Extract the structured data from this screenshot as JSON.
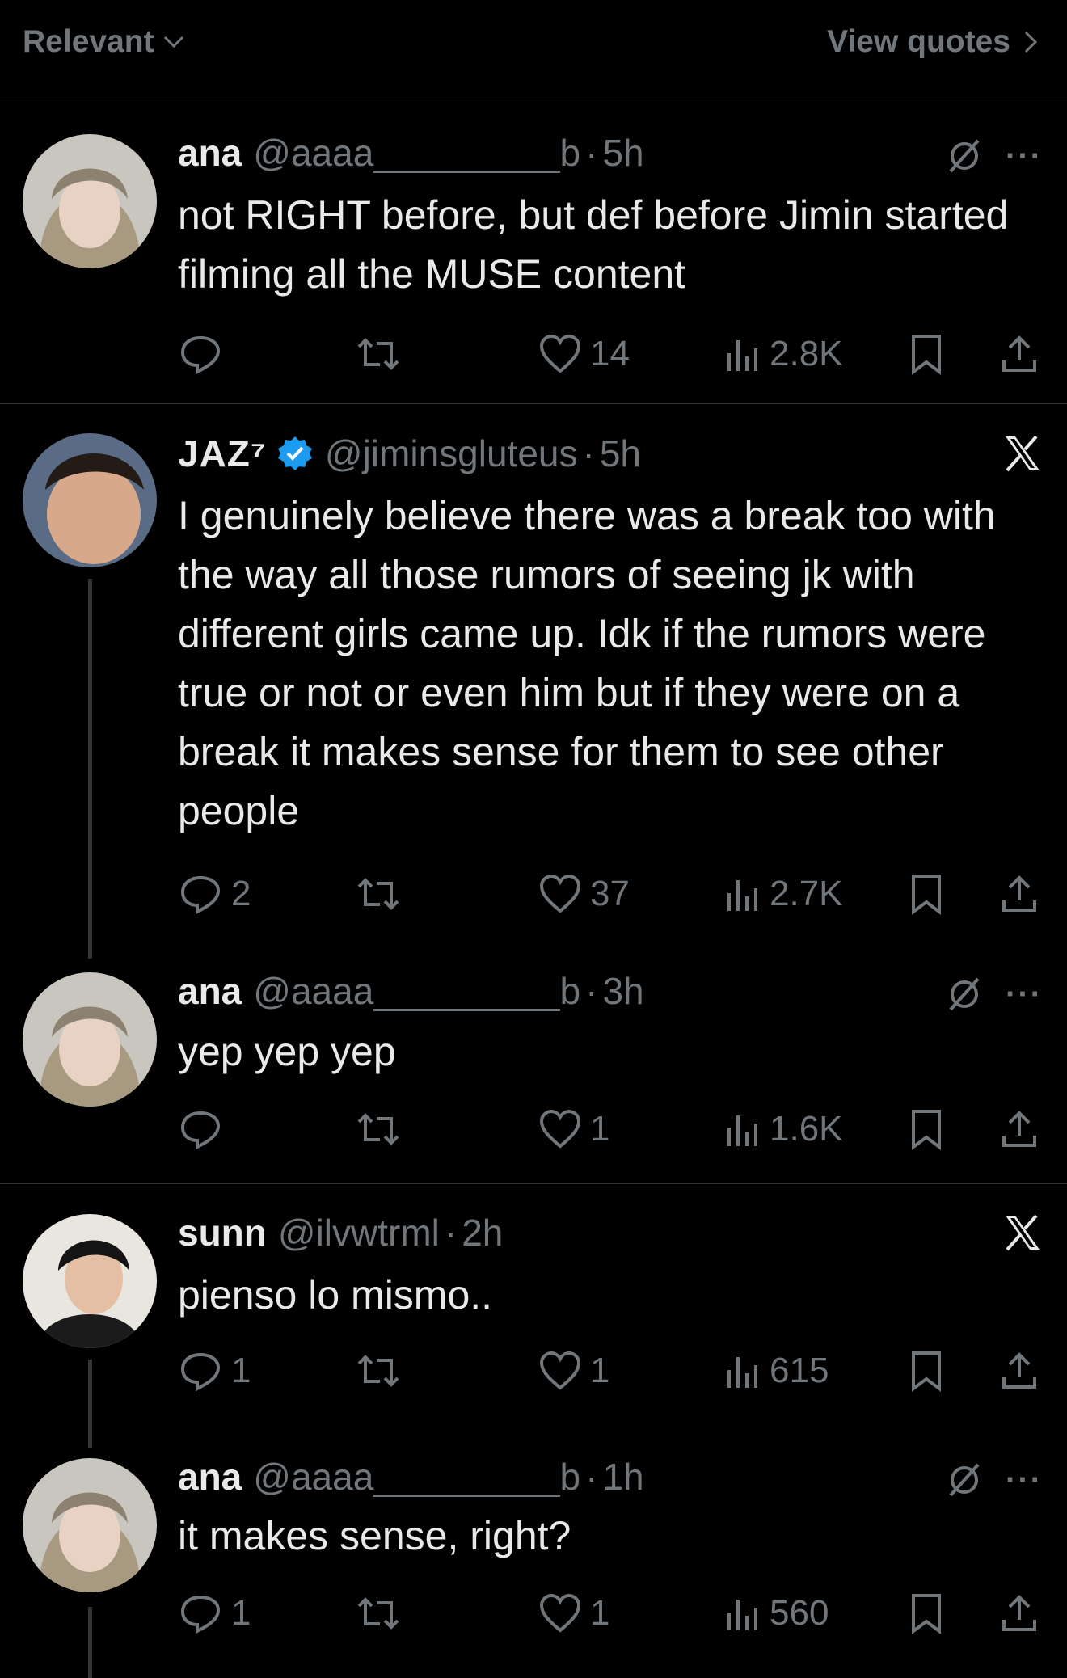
{
  "topbar": {
    "sort_label": "Relevant",
    "view_quotes_label": "View quotes"
  },
  "tweets": [
    {
      "name": "ana",
      "handle": "@aaaa_________b",
      "time": "5h",
      "text": "not RIGHT before, but def before Jimin started filming all the MUSE content",
      "replies": "",
      "likes": "14",
      "views": "2.8K"
    },
    {
      "name": "JAZ⁷",
      "handle": "@jiminsgluteus",
      "time": "5h",
      "text": "I genuinely believe there was a break too with the way all those rumors of seeing jk with different girls came up. Idk if the rumors were true or not or even him but if they were on a break it makes sense for them to see other people",
      "replies": "2",
      "likes": "37",
      "views": "2.7K"
    },
    {
      "name": "ana",
      "handle": "@aaaa_________b",
      "time": "3h",
      "text": "yep yep yep",
      "replies": "",
      "likes": "1",
      "views": "1.6K"
    },
    {
      "name": "sunn",
      "handle": "@ilvwtrml",
      "time": "2h",
      "text": "pienso lo mismo..",
      "replies": "1",
      "likes": "1",
      "views": "615"
    },
    {
      "name": "ana",
      "handle": "@aaaa_________b",
      "time": "1h",
      "text": "it makes sense, right?",
      "replies": "1",
      "likes": "1",
      "views": "560"
    }
  ],
  "colors": {
    "background": "#000000",
    "text": "#e7e9ea",
    "muted": "#71767b",
    "verified": "#1d9bf0",
    "divider": "#2f3336"
  },
  "icons": [
    "reply-icon",
    "retweet-icon",
    "like-icon",
    "views-icon",
    "bookmark-icon",
    "share-icon",
    "grok-icon",
    "x-logo-icon",
    "verified-icon",
    "more-icon"
  ]
}
